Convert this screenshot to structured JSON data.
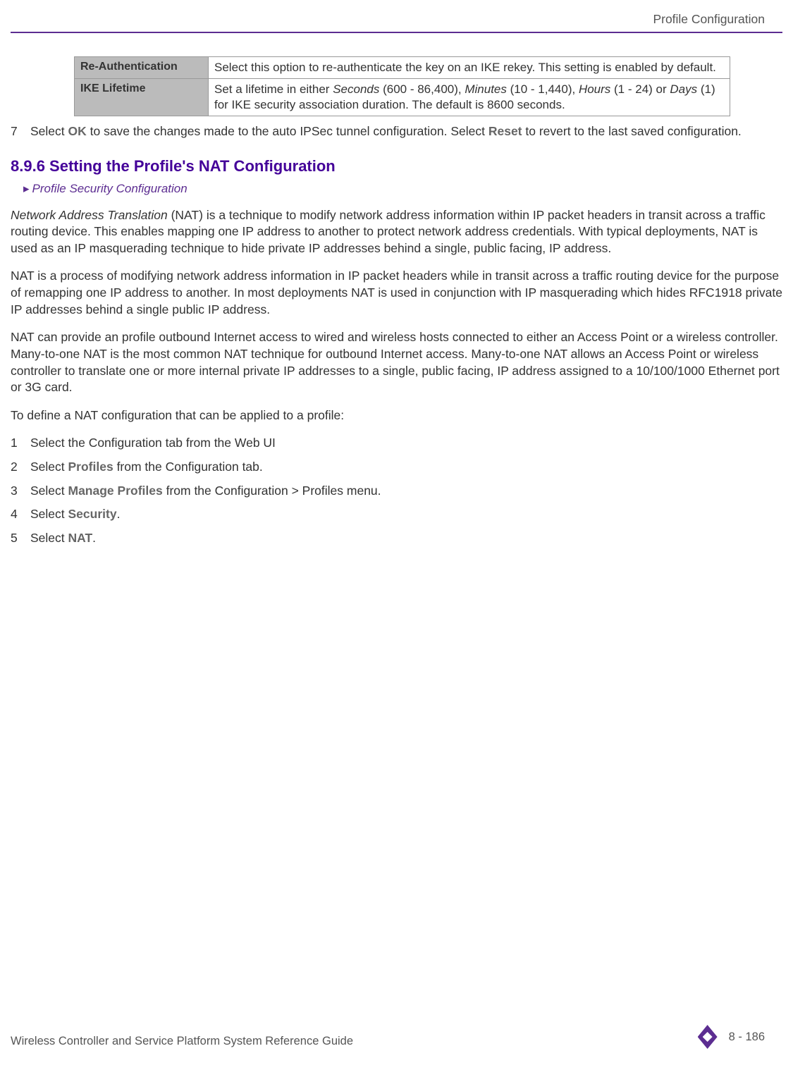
{
  "header": {
    "right_text": "Profile Configuration"
  },
  "table": {
    "rows": [
      {
        "label": "Re-Authentication",
        "desc": "Select this option to re-authenticate the key on an IKE rekey. This setting is enabled by default."
      },
      {
        "label": "IKE Lifetime",
        "desc_pre": "Set a lifetime in either ",
        "em1": "Seconds",
        "mid1": " (600 - 86,400), ",
        "em2": "Minutes",
        "mid2": " (10 - 1,440), ",
        "em3": "Hours",
        "mid3": " (1 - 24) or ",
        "em4": "Days",
        "desc_post": " (1) for IKE security association duration. The default is 8600 seconds."
      }
    ]
  },
  "step7": {
    "num": "7",
    "pre": "Select ",
    "ok": "OK",
    "mid": " to save the changes made to the auto IPSec tunnel configuration. Select ",
    "reset": "Reset",
    "post": " to revert to the last saved configuration."
  },
  "section": {
    "heading": "8.9.6 Setting the Profile's NAT Configuration",
    "breadcrumb_arrow": "▸",
    "breadcrumb": "Profile Security Configuration"
  },
  "p1": {
    "em": "Network Address Translation",
    "rest": " (NAT) is a technique to modify network address information within IP packet headers in transit across a traffic routing device. This enables mapping one IP address to another to protect network address credentials. With typical deployments, NAT is used as an IP masquerading technique to hide private IP addresses behind a single, public facing, IP address."
  },
  "p2": "NAT is a process of modifying network address information in IP packet headers while in transit across a traffic routing device for the purpose of remapping one IP address to another. In most deployments NAT is used in conjunction with IP masquerading which hides RFC1918 private IP addresses behind a single public IP address.",
  "p3": "NAT can provide an profile outbound Internet access to wired and wireless hosts connected to either an Access Point or a wireless controller. Many-to-one NAT is the most common NAT technique for outbound Internet access. Many-to-one NAT allows an Access Point or wireless controller to translate one or more internal private IP addresses to a single, public facing, IP address assigned to a 10/100/1000 Ethernet port or 3G card.",
  "p4": "To define a NAT configuration that can be applied to a profile:",
  "steps": [
    {
      "num": "1",
      "pre": "Select the Configuration tab from the Web UI",
      "bold": "",
      "post": ""
    },
    {
      "num": "2",
      "pre": "Select ",
      "bold": "Profiles",
      "post": " from the Configuration tab."
    },
    {
      "num": "3",
      "pre": "Select ",
      "bold": "Manage Profiles",
      "post": " from the Configuration > Profiles menu."
    },
    {
      "num": "4",
      "pre": "Select ",
      "bold": "Security",
      "post": "."
    },
    {
      "num": "5",
      "pre": "Select ",
      "bold": "NAT",
      "post": "."
    }
  ],
  "footer": {
    "left": "Wireless Controller and Service Platform System Reference Guide",
    "page": "8 - 186"
  }
}
